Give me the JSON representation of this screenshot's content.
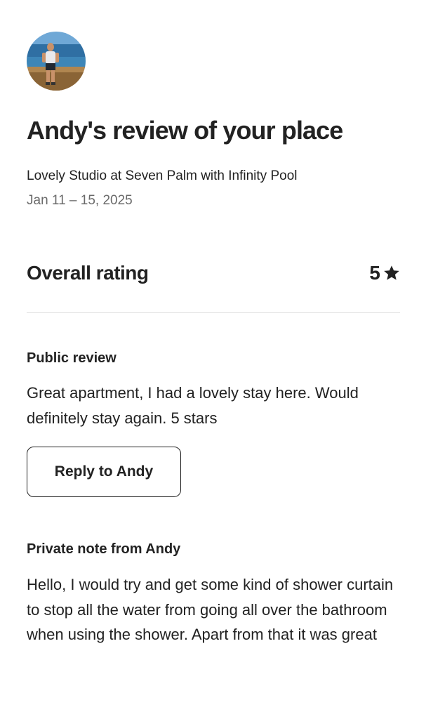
{
  "review": {
    "title": "Andy's review of your place",
    "listing_name": "Lovely Studio at Seven Palm with Infinity Pool",
    "dates": "Jan 11 – 15, 2025"
  },
  "rating": {
    "label": "Overall rating",
    "value": "5",
    "icon": "star-icon"
  },
  "public_review": {
    "heading": "Public review",
    "text": "Great apartment, I had a lovely stay here. Would definitely stay again. 5 stars",
    "reply_button_label": "Reply to Andy"
  },
  "private_note": {
    "heading": "Private note from Andy",
    "text": "Hello, I would try and get some kind of shower curtain to stop all the water from going all over the bathroom when using the shower. Apart from that it was great"
  },
  "colors": {
    "text_primary": "#222222",
    "text_secondary": "#6a6a6a",
    "divider": "#dddddd"
  }
}
